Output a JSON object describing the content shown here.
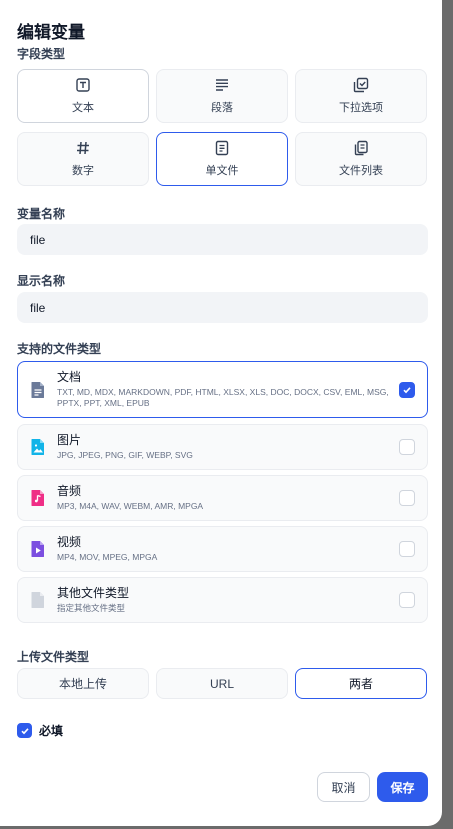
{
  "dialog": {
    "title": "编辑变量"
  },
  "field_type": {
    "label": "字段类型",
    "options": [
      {
        "label": "文本",
        "icon": "text-box-icon"
      },
      {
        "label": "段落",
        "icon": "paragraph-lines-icon"
      },
      {
        "label": "下拉选项",
        "icon": "select-check-icon"
      },
      {
        "label": "数字",
        "icon": "hash-icon"
      },
      {
        "label": "单文件",
        "icon": "single-file-icon"
      },
      {
        "label": "文件列表",
        "icon": "file-list-icon"
      }
    ],
    "selected": "单文件"
  },
  "variable_name": {
    "label": "变量名称",
    "value": "file"
  },
  "display_name": {
    "label": "显示名称",
    "value": "file"
  },
  "file_types": {
    "label": "支持的文件类型",
    "items": [
      {
        "name": "文档",
        "extensions": "TXT, MD, MDX, MARKDOWN, PDF, HTML, XLSX, XLS, DOC, DOCX, CSV, EML, MSG, PPTX, PPT, XML, EPUB",
        "color": "#6b7a99",
        "checked": true
      },
      {
        "name": "图片",
        "extensions": "JPG, JPEG, PNG, GIF, WEBP, SVG",
        "color": "#11b4e8",
        "checked": false
      },
      {
        "name": "音频",
        "extensions": "MP3, M4A, WAV, WEBM, AMR, MPGA",
        "color": "#ef2e86",
        "checked": false
      },
      {
        "name": "视频",
        "extensions": "MP4, MOV, MPEG, MPGA",
        "color": "#7c4fe0",
        "checked": false
      },
      {
        "name": "其他文件类型",
        "extensions": "指定其他文件类型",
        "color": "#d0d5dd",
        "checked": false
      }
    ]
  },
  "upload_method": {
    "label": "上传文件类型",
    "options": [
      "本地上传",
      "URL",
      "两者"
    ],
    "selected": "两者"
  },
  "required": {
    "label": "必填",
    "checked": true
  },
  "footer": {
    "cancel_label": "取消",
    "save_label": "保存"
  },
  "colors": {
    "accent": "#2e5bec"
  }
}
